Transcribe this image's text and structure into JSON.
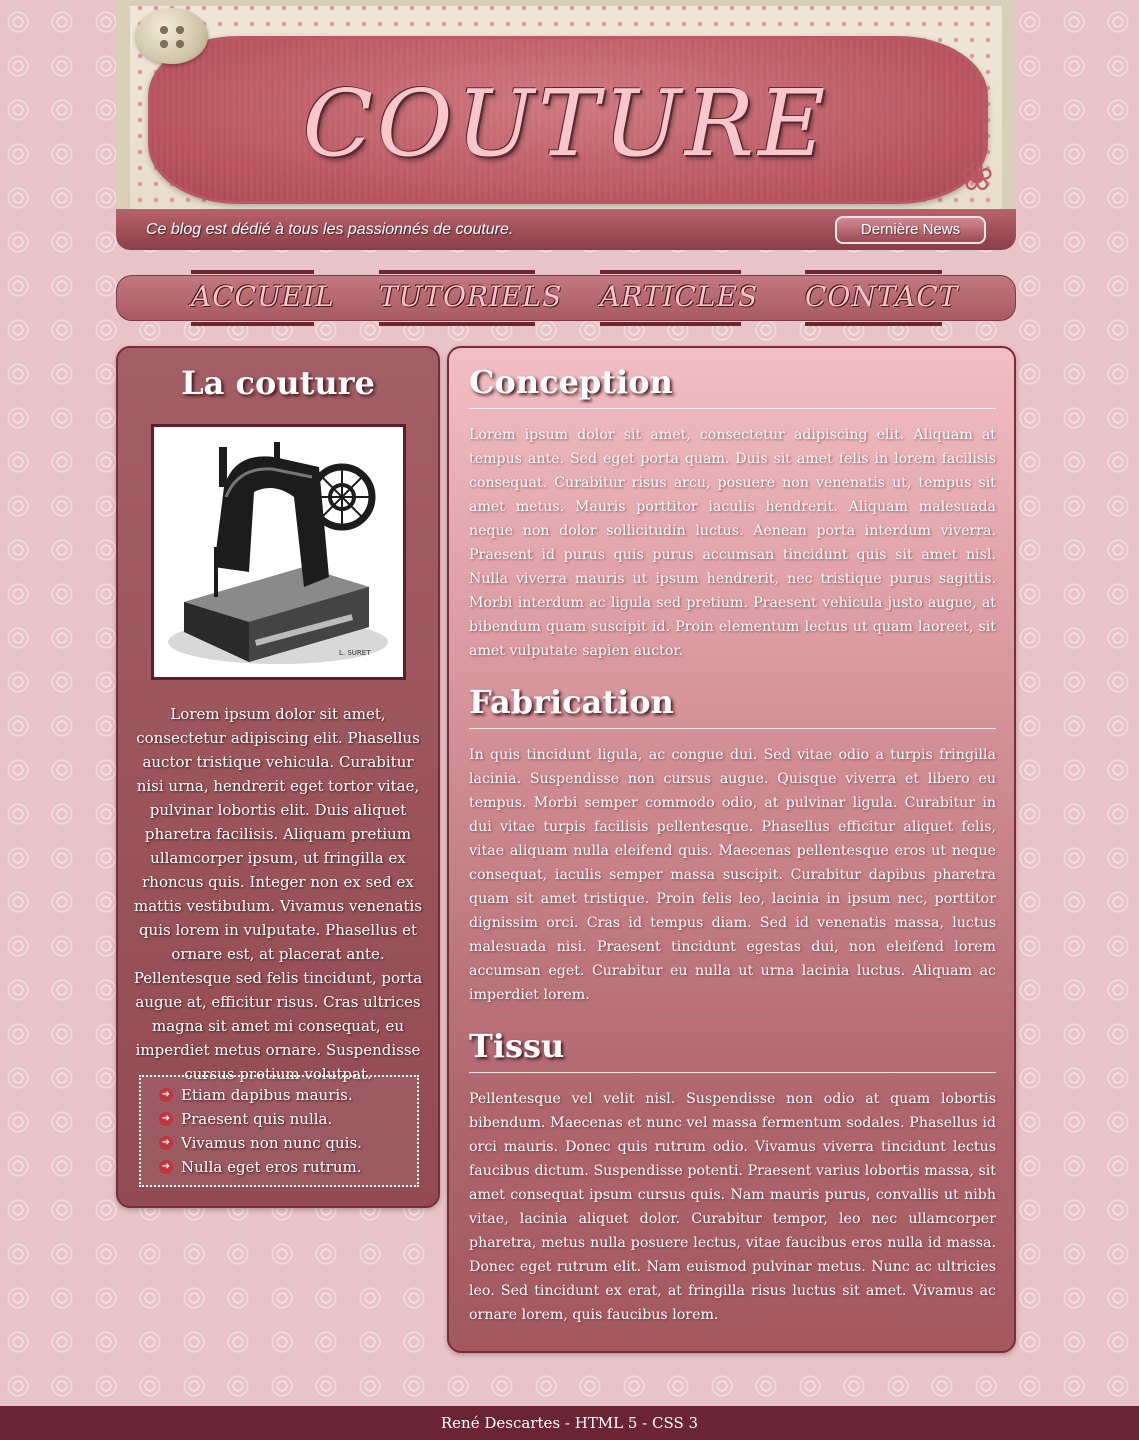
{
  "header": {
    "title": "COUTURE",
    "tagline": "Ce blog est dédié à tous les passionnés de couture.",
    "news_button": "Dernière News"
  },
  "nav": {
    "items": [
      {
        "label": "ACCUEIL"
      },
      {
        "label": "TUTORIELS"
      },
      {
        "label": "ARTICLES"
      },
      {
        "label": "CONTACT"
      }
    ]
  },
  "sidebar": {
    "title": "La couture",
    "image_alt": "sewing-machine-engraving",
    "image_caption": "L. SURET",
    "text": "Lorem ipsum dolor sit amet, consectetur adipiscing elit. Phasellus auctor tristique vehicula. Curabitur nisi urna, hendrerit eget tortor vitae, pulvinar lobortis elit. Duis aliquet pharetra facilisis. Aliquam pretium ullamcorper ipsum, ut fringilla ex rhoncus quis. Integer non ex sed ex mattis vestibulum. Vivamus venenatis quis lorem in vulputate. Phasellus et ornare est, at placerat ante. Pellentesque sed felis tincidunt, porta augue at, efficitur risus. Cras ultrices magna sit amet mi consequat, eu imperdiet metus ornare. Suspendisse cursus pretium volutpat.",
    "list": [
      "Etiam dapibus mauris.",
      "Praesent quis nulla.",
      "Vivamus non nunc quis.",
      "Nulla eget eros rutrum."
    ]
  },
  "main": {
    "sections": [
      {
        "heading": "Conception",
        "text": "Lorem ipsum dolor sit amet, consectetur adipiscing elit. Aliquam at tempus ante. Sed eget porta quam. Duis sit amet felis in lorem facilisis consequat. Curabitur risus arcu, posuere non venenatis ut, tempus sit amet metus. Mauris porttitor iaculis hendrerit. Aliquam malesuada neque non dolor sollicitudin luctus. Aenean porta interdum viverra. Praesent id purus quis purus accumsan tincidunt quis sit amet nisl. Nulla viverra mauris ut ipsum hendrerit, nec tristique purus sagittis. Morbi interdum ac ligula sed pretium. Praesent vehicula justo augue, at bibendum quam suscipit id. Proin elementum lectus ut quam laoreet, sit amet vulputate sapien auctor."
      },
      {
        "heading": "Fabrication",
        "text": "In quis tincidunt ligula, ac congue dui. Sed vitae odio a turpis fringilla lacinia. Suspendisse non cursus augue. Quisque viverra et libero eu tempus. Morbi semper commodo odio, at pulvinar ligula. Curabitur in dui vitae turpis facilisis pellentesque. Phasellus efficitur aliquet felis, vitae aliquam nulla eleifend quis. Maecenas pellentesque eros ut neque consequat, iaculis semper massa suscipit. Curabitur dapibus pharetra quam sit amet tristique. Proin felis leo, lacinia in ipsum nec, porttitor dignissim orci. Cras id tempus diam. Sed id venenatis massa, luctus malesuada nisi. Praesent tincidunt egestas dui, non eleifend lorem accumsan eget. Curabitur eu nulla ut urna lacinia luctus. Aliquam ac imperdiet lorem."
      },
      {
        "heading": "Tissu",
        "text": "Pellentesque vel velit nisl. Suspendisse non odio at quam lobortis bibendum. Maecenas et nunc vel massa fermentum sodales. Phasellus id orci mauris. Donec quis rutrum odio. Vivamus viverra tincidunt lectus faucibus dictum. Suspendisse potenti. Praesent varius lobortis massa, sit amet consequat ipsum cursus quis. Nam mauris purus, convallis ut nibh vitae, lacinia aliquet dolor. Curabitur tempor, leo nec ullamcorper pharetra, metus nulla posuere lectus, vitae faucibus eros nulla id massa. Donec eget rutrum elit. Nam euismod pulvinar metus. Nunc ac ultricies leo. Sed tincidunt ex erat, at fringilla risus luctus sit amet. Vivamus ac ornare lorem, quis faucibus lorem."
      }
    ]
  },
  "footer": {
    "text": "René Descartes - HTML 5 - CSS 3"
  },
  "colors": {
    "page_background": "#e8c3c7",
    "accent_dark": "#7a2d38",
    "panel": "#a45e66",
    "footer": "#6a2433"
  }
}
